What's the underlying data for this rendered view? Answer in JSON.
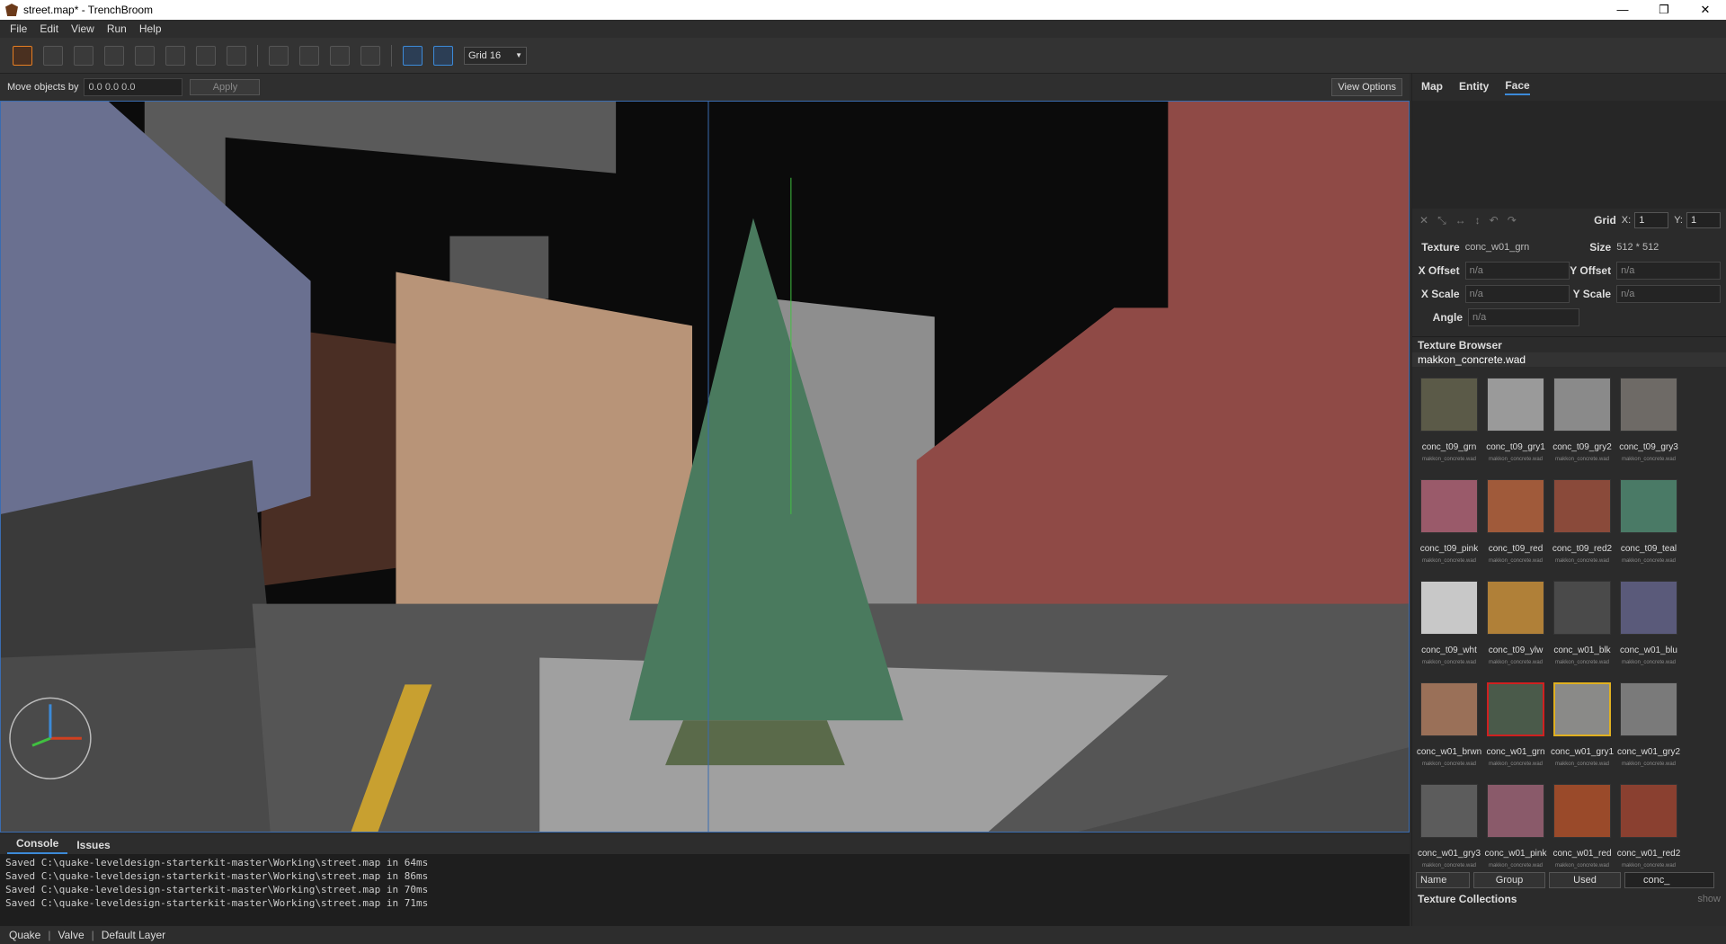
{
  "window": {
    "title": "street.map* - TrenchBroom",
    "min": "—",
    "max": "❐",
    "close": "✕"
  },
  "menu": [
    "File",
    "Edit",
    "View",
    "Run",
    "Help"
  ],
  "toolbar": {
    "grid_label": "Grid 16"
  },
  "movebar": {
    "label": "Move objects by",
    "value": "0.0 0.0 0.0",
    "apply": "Apply",
    "view_options": "View Options"
  },
  "console": {
    "tabs": [
      "Console",
      "Issues"
    ],
    "lines": [
      "Saved C:\\quake-leveldesign-starterkit-master\\Working\\street.map in 64ms",
      "Saved C:\\quake-leveldesign-starterkit-master\\Working\\street.map in 86ms",
      "Saved C:\\quake-leveldesign-starterkit-master\\Working\\street.map in 70ms",
      "Saved C:\\quake-leveldesign-starterkit-master\\Working\\street.map in 71ms"
    ]
  },
  "statusbar": {
    "game": "Quake",
    "format": "Valve",
    "layer": "Default Layer"
  },
  "inspector": {
    "tabs": [
      "Map",
      "Entity",
      "Face"
    ],
    "grid": {
      "label": "Grid",
      "x_label": "X:",
      "x": "1",
      "y_label": "Y:",
      "y": "1"
    },
    "texture": {
      "label": "Texture",
      "value": "conc_w01_grn",
      "size_label": "Size",
      "size": "512 * 512"
    },
    "x_offset": {
      "label": "X Offset",
      "value": "n/a"
    },
    "y_offset": {
      "label": "Y Offset",
      "value": "n/a"
    },
    "x_scale": {
      "label": "X Scale",
      "value": "n/a"
    },
    "y_scale": {
      "label": "Y Scale",
      "value": "n/a"
    },
    "angle": {
      "label": "Angle",
      "value": "n/a"
    }
  },
  "texture_browser": {
    "title": "Texture Browser",
    "wad": "makkon_concrete.wad",
    "wad_small": "makkon_concrete.wad",
    "textures": [
      {
        "name": "conc_t09_grn",
        "color": "#5b5a48"
      },
      {
        "name": "conc_t09_gry1",
        "color": "#9a9a9a"
      },
      {
        "name": "conc_t09_gry2",
        "color": "#8a8a8a"
      },
      {
        "name": "conc_t09_gry3",
        "color": "#6e6a66"
      },
      {
        "name": "conc_t09_pink",
        "color": "#9a5a6a"
      },
      {
        "name": "conc_t09_red",
        "color": "#a05a3a"
      },
      {
        "name": "conc_t09_red2",
        "color": "#8a4a3a"
      },
      {
        "name": "conc_t09_teal",
        "color": "#4a7a66"
      },
      {
        "name": "conc_t09_wht",
        "color": "#c8c8c8"
      },
      {
        "name": "conc_t09_ylw",
        "color": "#b08038"
      },
      {
        "name": "conc_w01_blk",
        "color": "#4a4a4a"
      },
      {
        "name": "conc_w01_blu",
        "color": "#5a5a7a"
      },
      {
        "name": "conc_w01_brwn",
        "color": "#9a7058"
      },
      {
        "name": "conc_w01_grn",
        "color": "#4a5a4a"
      },
      {
        "name": "conc_w01_gry1",
        "color": "#8a8a88"
      },
      {
        "name": "conc_w01_gry2",
        "color": "#7a7a7a"
      },
      {
        "name": "conc_w01_gry3",
        "color": "#5c5c5c"
      },
      {
        "name": "conc_w01_pink",
        "color": "#8a5a6a"
      },
      {
        "name": "conc_w01_red",
        "color": "#9a4a2a"
      },
      {
        "name": "conc_w01_red2",
        "color": "#8a4030"
      },
      {
        "name": "",
        "color": "#3a6a4a"
      },
      {
        "name": "",
        "color": "#c8c8c8"
      },
      {
        "name": "",
        "color": "#a87838"
      },
      {
        "name": "",
        "color": "#505050"
      }
    ],
    "filter": {
      "sort": "Name",
      "group": "Group",
      "used": "Used",
      "search": "conc_"
    },
    "collections": "Texture Collections",
    "show": "show"
  }
}
